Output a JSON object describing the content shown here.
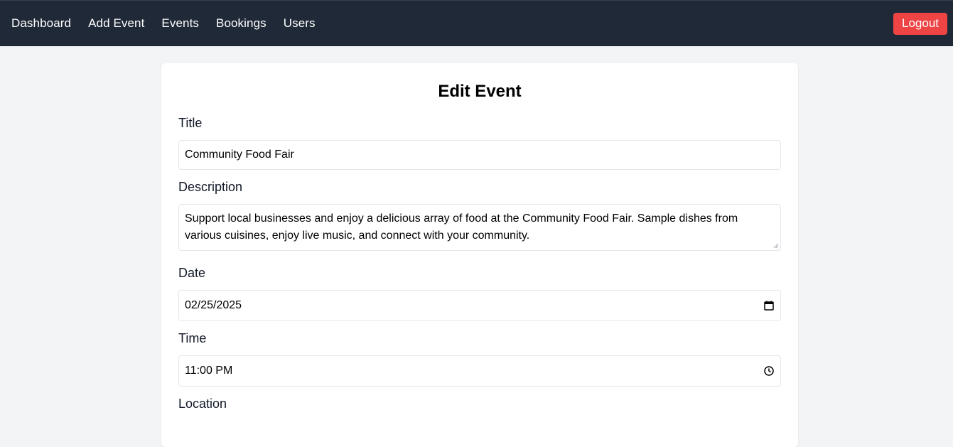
{
  "nav": {
    "links": [
      "Dashboard",
      "Add Event",
      "Events",
      "Bookings",
      "Users"
    ],
    "logout_label": "Logout"
  },
  "form": {
    "heading": "Edit Event",
    "title_label": "Title",
    "title_value": "Community Food Fair",
    "description_label": "Description",
    "description_value": "Support local businesses and enjoy a delicious array of food at the Community Food Fair.  Sample dishes from various cuisines, enjoy live music, and connect with your community.",
    "date_label": "Date",
    "date_value": "02/25/2025",
    "time_label": "Time",
    "time_value": "11:00 PM",
    "location_label": "Location"
  },
  "icons": {
    "date": "calendar-icon",
    "time": "clock-icon"
  },
  "colors": {
    "navbar": "#1f2937",
    "logout": "#ef4444",
    "background": "#f3f4f6"
  }
}
